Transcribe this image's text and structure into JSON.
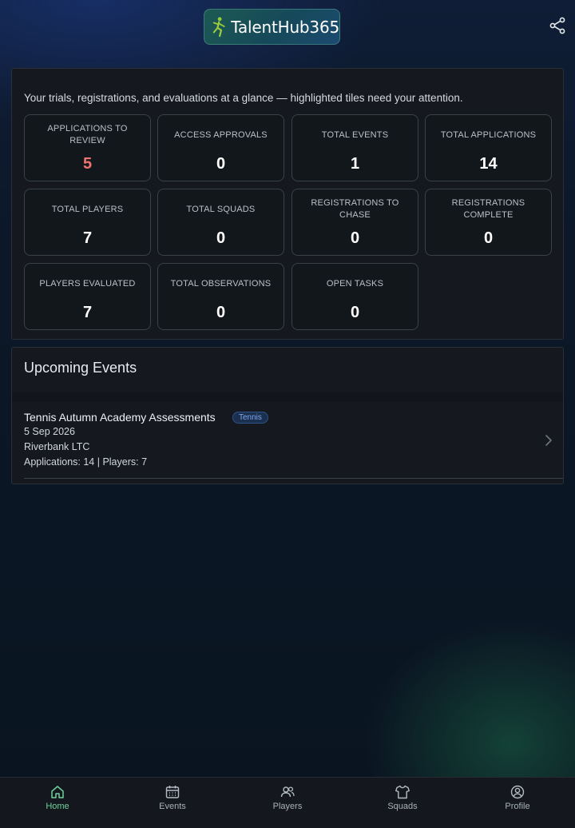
{
  "header": {
    "brand": "TalentHub365",
    "share_icon": "share-icon"
  },
  "summary": {
    "intro": "Your trials, registrations, and evaluations at a glance — highlighted tiles need your attention.",
    "tiles": [
      {
        "label": "APPLICATIONS TO REVIEW",
        "value": "5",
        "highlight": true
      },
      {
        "label": "ACCESS APPROVALS",
        "value": "0"
      },
      {
        "label": "TOTAL EVENTS",
        "value": "1"
      },
      {
        "label": "TOTAL APPLICATIONS",
        "value": "14"
      },
      {
        "label": "TOTAL PLAYERS",
        "value": "7"
      },
      {
        "label": "TOTAL SQUADS",
        "value": "0"
      },
      {
        "label": "REGISTRATIONS TO CHASE",
        "value": "0"
      },
      {
        "label": "REGISTRATIONS COMPLETE",
        "value": "0"
      },
      {
        "label": "PLAYERS EVALUATED",
        "value": "7"
      },
      {
        "label": "TOTAL OBSERVATIONS",
        "value": "0"
      },
      {
        "label": "OPEN TASKS",
        "value": "0"
      }
    ],
    "highlight_color": "#f0736f"
  },
  "events": {
    "title": "Upcoming Events",
    "items": [
      {
        "name": "Tennis Autumn Academy Assessments",
        "sport": "Tennis",
        "date": "5 Sep 2026",
        "venue": "Riverbank LTC",
        "stats": "Applications: 14 | Players: 7"
      }
    ]
  },
  "nav": {
    "active_color": "#6fd19a",
    "items": [
      {
        "label": "Home",
        "icon": "home-icon",
        "active": true
      },
      {
        "label": "Events",
        "icon": "calendar-icon"
      },
      {
        "label": "Players",
        "icon": "players-icon"
      },
      {
        "label": "Squads",
        "icon": "shirt-icon"
      },
      {
        "label": "Profile",
        "icon": "profile-icon"
      }
    ]
  }
}
